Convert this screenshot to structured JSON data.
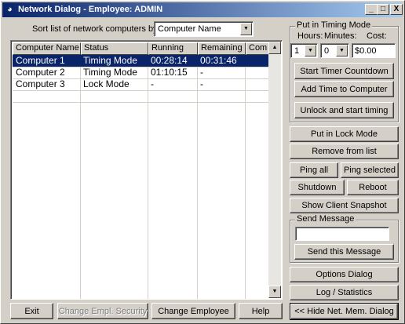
{
  "window": {
    "title": "Network Dialog - Employee: ADMIN",
    "app_icon": "network-eye-icon",
    "controls": {
      "minimize": "_",
      "maximize": "□",
      "close": "X"
    }
  },
  "sort": {
    "label": "Sort list of network computers by:",
    "selected": "Computer Name"
  },
  "table": {
    "columns": [
      "Computer Name",
      "Status",
      "Running",
      "Remaining",
      "Com"
    ],
    "rows": [
      {
        "name": "Computer 1",
        "status": "Timing Mode",
        "running": "00:28:14",
        "remaining": "00:31:46",
        "com": "",
        "selected": true
      },
      {
        "name": "Computer 2",
        "status": "Timing Mode",
        "running": "01:10:15",
        "remaining": "-",
        "com": ""
      },
      {
        "name": "Computer 3",
        "status": "Lock Mode",
        "running": "-",
        "remaining": "-",
        "com": ""
      }
    ]
  },
  "timing": {
    "group_label": "Put in Timing Mode",
    "hours_label": "Hours:",
    "minutes_label": "Minutes:",
    "cost_label": "Cost:",
    "hours_value": "1",
    "minutes_value": "0",
    "cost_value": "$0.00",
    "start_timer": "Start Timer Countdown",
    "add_time": "Add Time to Computer",
    "unlock_start": "Unlock and start timing"
  },
  "actions": {
    "lock_mode": "Put in Lock Mode",
    "remove": "Remove from list",
    "ping_all": "Ping all",
    "ping_selected": "Ping selected",
    "shutdown": "Shutdown",
    "reboot": "Reboot",
    "snapshot": "Show Client Snapshot"
  },
  "message": {
    "group_label": "Send Message",
    "input_value": "",
    "send": "Send this Message"
  },
  "side_bottom": {
    "options": "Options Dialog",
    "log": "Log / Statistics",
    "hide": "<< Hide Net. Mem. Dialog"
  },
  "footer": {
    "exit": "Exit",
    "change_security": "Change Empl. Security",
    "change_employee": "Change Employee",
    "help": "Help"
  }
}
